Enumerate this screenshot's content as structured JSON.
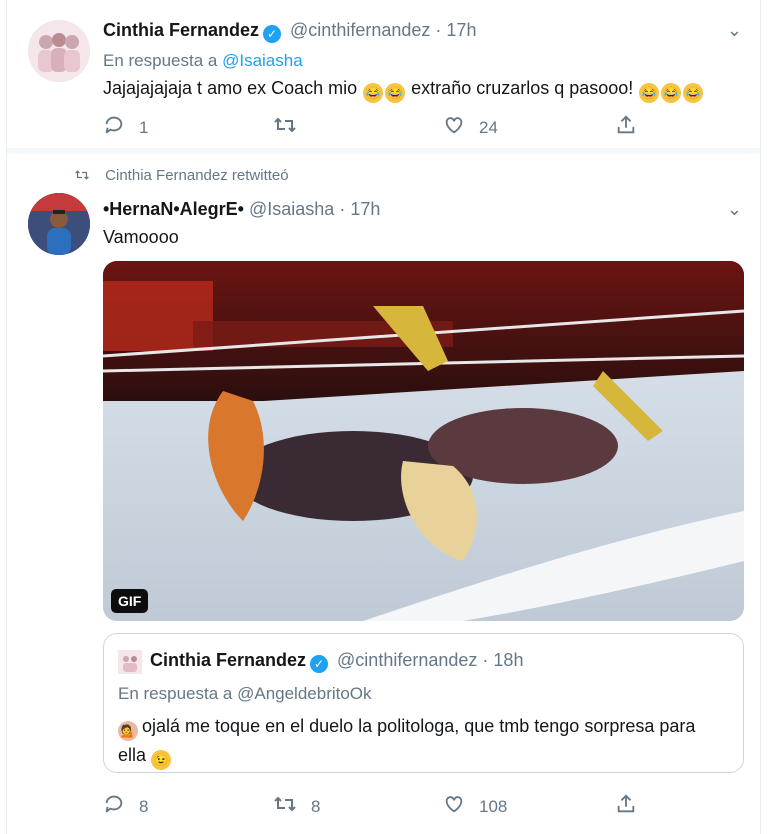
{
  "tweet1": {
    "name": "Cinthia Fernandez",
    "handle": "@cinthifernandez",
    "dot": "·",
    "time": "17h",
    "reply_prefix": "En respuesta a",
    "reply_handle": "@Isaiasha",
    "text_a": "Jajajajajaja t amo ex Coach mio",
    "text_b": "extraño cruzarlos q pasooo!",
    "replies": "1",
    "retweets": "",
    "likes": "24"
  },
  "retweet_label": "Cinthia Fernandez retwitteó",
  "tweet2": {
    "name": "•HernaN•AlegrE•",
    "handle": "@Isaiasha",
    "dot": "·",
    "time": "17h",
    "text": "Vamoooo",
    "media_badge": "GIF",
    "replies": "8",
    "retweets": "8",
    "likes": "108"
  },
  "quoted": {
    "name": "Cinthia Fernandez",
    "handle": "@cinthifernandez",
    "dot": "·",
    "time": "18h",
    "reply_prefix": "En respuesta a",
    "reply_handle": "@AngeldebritoOk",
    "text_a": "ojalá me toque en el duelo la politologa, que tmb tengo sorpresa para ella"
  },
  "colors": {
    "accent": "#1da1f2",
    "muted": "#657786",
    "border": "#e6ecf0"
  },
  "icons": {
    "reply": "reply-icon",
    "retweet": "retweet-icon",
    "like": "heart-icon",
    "share": "share-icon",
    "verified": "verified-badge-icon",
    "menu": "chevron-down-icon"
  }
}
